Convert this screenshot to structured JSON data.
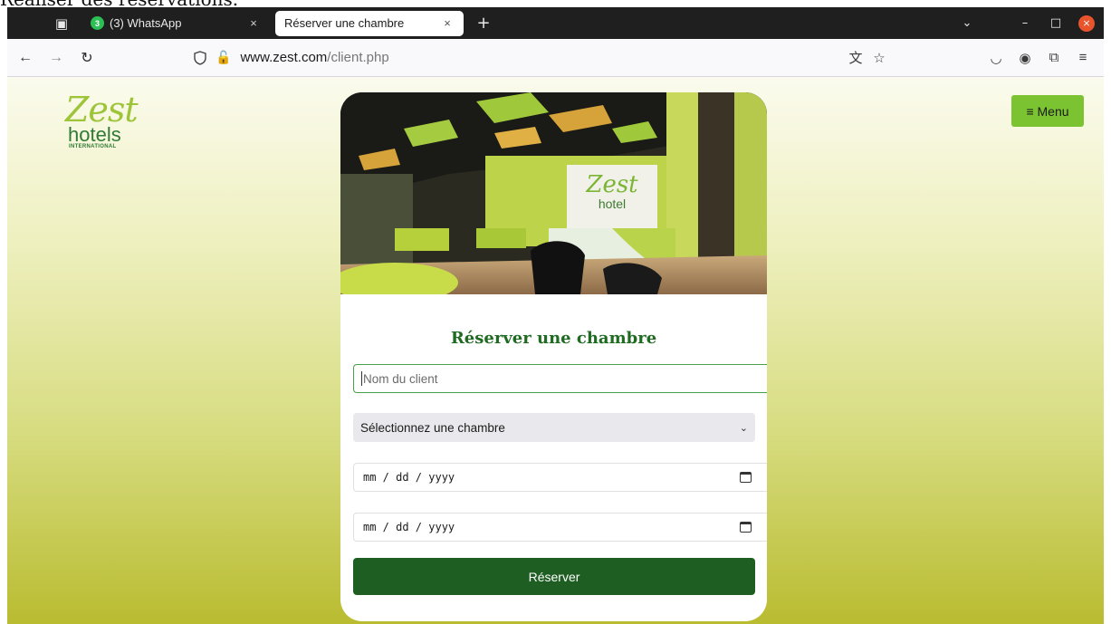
{
  "doc_title": "Réaliser des réservations.",
  "browser": {
    "tabs": [
      {
        "label": "(3) WhatsApp",
        "badge": "3",
        "active": false
      },
      {
        "label": "Réserver une chambre",
        "active": true
      }
    ],
    "close_glyph": "×",
    "new_tab_glyph": "+",
    "url_domain": "www.zest.com",
    "url_path": "/client.php",
    "window_controls": {
      "minimize": "–",
      "maximize": "□",
      "close": "×"
    }
  },
  "page": {
    "logo": {
      "word": "Zest",
      "sub": "hotels",
      "tagline": "INTERNATIONAL"
    },
    "menu_label": "≡ Menu",
    "form": {
      "title": "Réserver une chambre",
      "name_placeholder": "Nom du client",
      "room_select_value": "Sélectionnez une chambre",
      "date_in_placeholder": "mm / dd / yyyy",
      "date_out_placeholder": "mm / dd / yyyy",
      "submit_label": "Réserver"
    }
  },
  "colors": {
    "accent_green": "#7cc331",
    "button_dark_green": "#1f5e22",
    "title_green": "#1f6b21"
  }
}
